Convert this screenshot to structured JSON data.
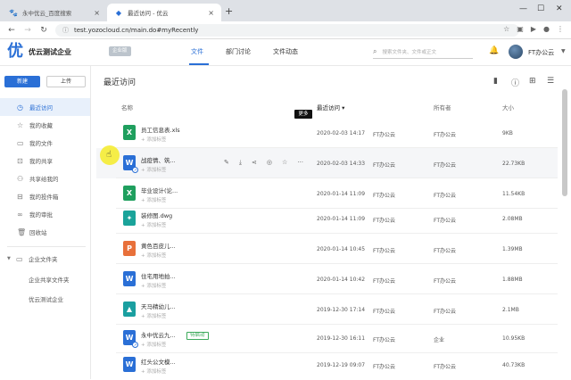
{
  "browser": {
    "tabs": [
      {
        "label": "永中优云_百度搜索",
        "icon": "baidu-icon"
      },
      {
        "label": "最近访问 - 优云",
        "icon": "yozo-cloud-icon"
      }
    ],
    "url": "test.yozocloud.cn/main.do#myRecently"
  },
  "header": {
    "logo": "优",
    "company": "优云测试企业",
    "badge": "企业版",
    "nav": [
      "文件",
      "部门讨论",
      "文件动态"
    ],
    "search_placeholder": "搜索文件夹、文件或正文",
    "user": "FT办公云"
  },
  "sidebar": {
    "new_label": "新建",
    "upload_label": "上传",
    "items": [
      {
        "label": "最近访问",
        "icon": "clock-icon"
      },
      {
        "label": "我的收藏",
        "icon": "star-icon"
      },
      {
        "label": "我的文件",
        "icon": "file-icon"
      },
      {
        "label": "我的共享",
        "icon": "share-icon"
      },
      {
        "label": "共享给我的",
        "icon": "shared-icon"
      },
      {
        "label": "我的投件箱",
        "icon": "inbox-icon"
      },
      {
        "label": "我的审批",
        "icon": "approval-icon"
      },
      {
        "label": "回收站",
        "icon": "trash-icon"
      }
    ],
    "enterprise_label": "企业文件夹",
    "enterprise_subs": [
      "企业共享文件夹",
      "优云测试企业"
    ]
  },
  "main": {
    "title": "最近访问",
    "col_name": "名称",
    "col_recent": "最近访问",
    "col_owner": "所有者",
    "col_size": "大小",
    "tooltip": "更多",
    "tag_placeholder": "+ 添加标签",
    "rows": [
      {
        "name": "员工信息表.xls",
        "type": "xls",
        "letter": "X",
        "date": "2020-02-03 14:17",
        "last": "FT办公云",
        "owner": "FT办公云",
        "size": "9KB"
      },
      {
        "name": "战疫情、筑...",
        "type": "doc",
        "letter": "W",
        "date": "2020-02-03 14:33",
        "last": "FT办公云",
        "owner": "FT办公云",
        "size": "22.73KB"
      },
      {
        "name": "毕业设计(论...",
        "type": "xls",
        "letter": "X",
        "date": "2020-01-14 11:09",
        "last": "FT办公云",
        "owner": "FT办公云",
        "size": "11.54KB"
      },
      {
        "name": "装修图.dwg",
        "type": "dwg",
        "letter": "✦",
        "date": "2020-01-14 11:09",
        "last": "FT办公云",
        "owner": "FT办公云",
        "size": "2.08MB"
      },
      {
        "name": "黄色百皮儿...",
        "type": "ppt",
        "letter": "P",
        "date": "2020-01-14 10:45",
        "last": "FT办公云",
        "owner": "FT办公云",
        "size": "1.39MB"
      },
      {
        "name": "住宅用地拍...",
        "type": "doc",
        "letter": "W",
        "date": "2020-01-14 10:42",
        "last": "FT办公云",
        "owner": "FT办公云",
        "size": "1.88MB"
      },
      {
        "name": "天马精幼儿...",
        "type": "pdf",
        "letter": "▲",
        "date": "2019-12-30 17:14",
        "last": "FT办公云",
        "owner": "FT办公云",
        "size": "2.1MB"
      },
      {
        "name": "永中优云九...",
        "type": "doc",
        "letter": "W",
        "date": "2019-12-30 16:11",
        "last": "FT办公云",
        "owner": "企业",
        "size": "10.95KB",
        "status": "待启动"
      },
      {
        "name": "红头公文模...",
        "type": "doc",
        "letter": "W",
        "date": "2019-12-19 09:07",
        "last": "FT办公云",
        "owner": "FT办公云",
        "size": "40.73KB"
      }
    ]
  },
  "colors": {
    "accent": "#2a6fd6",
    "cursor_highlight": "#f5eb28"
  }
}
